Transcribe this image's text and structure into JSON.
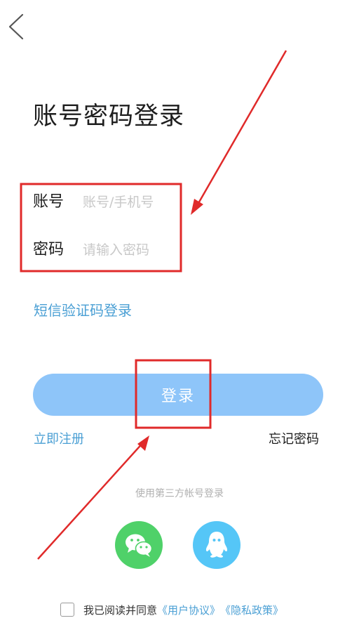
{
  "page": {
    "title": "账号密码登录"
  },
  "form": {
    "account_label": "账号",
    "account_placeholder": "账号/手机号",
    "password_label": "密码",
    "password_placeholder": "请输入密码"
  },
  "links": {
    "sms_login": "短信验证码登录",
    "register": "立即注册",
    "forgot_password": "忘记密码"
  },
  "login_button": {
    "label": "登录"
  },
  "third_party": {
    "label": "使用第三方帐号登录",
    "providers": [
      {
        "name": "wechat",
        "icon": "wechat-icon",
        "color": "#4fd169"
      },
      {
        "name": "qq",
        "icon": "qq-icon",
        "color": "#55c6f7"
      }
    ]
  },
  "agreement": {
    "prefix": "我已阅读并同意",
    "user_agreement": "《用户协议》",
    "privacy_policy": "《隐私政策》",
    "checked": false
  },
  "colors": {
    "accent": "#4a9fd4",
    "button": "#8ec5f9",
    "annotation": "#e02a2a"
  }
}
